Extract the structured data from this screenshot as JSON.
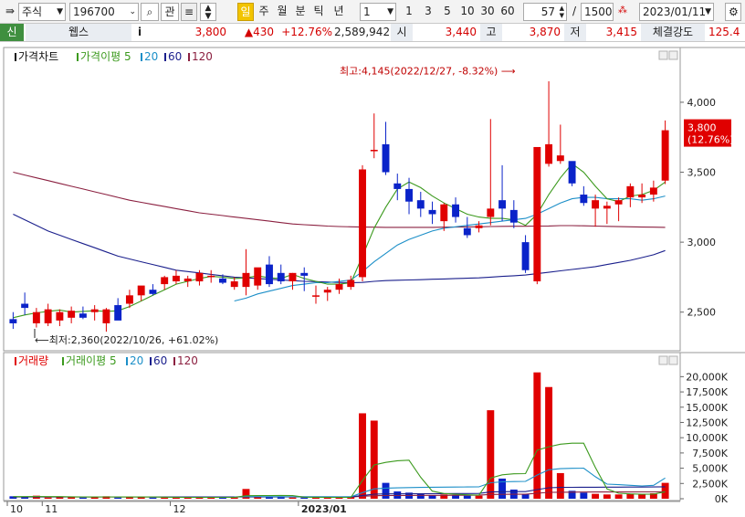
{
  "toolbar": {
    "market": "주식",
    "code": "196700",
    "gwan": "관",
    "periods": [
      "일",
      "주",
      "월",
      "분",
      "틱",
      "년"
    ],
    "multiplier": "1",
    "quick": [
      "1",
      "3",
      "5",
      "10",
      "30",
      "60"
    ],
    "count": "57",
    "total": "1500",
    "date": "2023/01/11",
    "slash": "/"
  },
  "info": {
    "tag": "신",
    "name": "웹스",
    "i": "i",
    "price": "3,800",
    "change": "▲430",
    "rate": "+12.76%",
    "volume": "2,589,942",
    "open_label": "시",
    "open": "3,440",
    "high_label": "고",
    "high": "3,870",
    "low_label": "저",
    "low": "3,415",
    "strength_label": "체결강도",
    "strength": "125.4"
  },
  "colors": {
    "up": "#e00000",
    "down": "#0a23c9",
    "ma5": "#3c9a1e",
    "ma20": "#1c8fc8",
    "ma60": "#1a1f8c",
    "ma120": "#8b2040"
  },
  "chart_data": [
    {
      "type": "candlestick",
      "title": "가격차트",
      "legend": [
        {
          "name": "가격이평",
          "period": "5",
          "color": "#3c9a1e"
        },
        {
          "name": "",
          "period": "20",
          "color": "#1c8fc8"
        },
        {
          "name": "",
          "period": "60",
          "color": "#1a1f8c"
        },
        {
          "name": "",
          "period": "120",
          "color": "#8b2040"
        }
      ],
      "y_ticks": [
        "4,000",
        "3,500",
        "3,000",
        "2,500"
      ],
      "y_tick_values": [
        4000,
        3500,
        3000,
        2500
      ],
      "ylim": [
        2250,
        4300
      ],
      "x_ticks": [
        {
          "label": "10",
          "index": 0
        },
        {
          "label": "11",
          "index": 3
        },
        {
          "label": "12",
          "index": 14
        },
        {
          "label": "2023/01",
          "index": 25
        }
      ],
      "current_label": [
        "3,800",
        "(12.76%)"
      ],
      "annotations": [
        {
          "text": "최고:4,145(2022/12/27, -8.32%)",
          "value": 4145
        },
        {
          "text": "최저:2,360(2022/10/26, +61.02%)",
          "value": 2360
        }
      ],
      "ohlc": [
        [
          2450,
          2500,
          2380,
          2420
        ],
        [
          2560,
          2640,
          2480,
          2530
        ],
        [
          2420,
          2530,
          2390,
          2500
        ],
        [
          2420,
          2560,
          2400,
          2520
        ],
        [
          2440,
          2520,
          2400,
          2500
        ],
        [
          2460,
          2540,
          2420,
          2510
        ],
        [
          2490,
          2540,
          2450,
          2460
        ],
        [
          2500,
          2550,
          2440,
          2520
        ],
        [
          2420,
          2530,
          2360,
          2520
        ],
        [
          2550,
          2600,
          2460,
          2440
        ],
        [
          2560,
          2660,
          2530,
          2620
        ],
        [
          2620,
          2680,
          2580,
          2690
        ],
        [
          2660,
          2700,
          2620,
          2630
        ],
        [
          2700,
          2760,
          2660,
          2750
        ],
        [
          2720,
          2800,
          2700,
          2760
        ],
        [
          2720,
          2760,
          2680,
          2740
        ],
        [
          2720,
          2800,
          2690,
          2780
        ],
        [
          2750,
          2800,
          2710,
          2760
        ],
        [
          2740,
          2770,
          2700,
          2710
        ],
        [
          2680,
          2750,
          2660,
          2720
        ],
        [
          2680,
          2950,
          2620,
          2780
        ],
        [
          2690,
          2760,
          2660,
          2820
        ],
        [
          2840,
          2900,
          2680,
          2700
        ],
        [
          2780,
          2840,
          2700,
          2720
        ],
        [
          2720,
          2780,
          2660,
          2780
        ],
        [
          2780,
          2820,
          2650,
          2760
        ],
        [
          2610,
          2690,
          2560,
          2620
        ],
        [
          2640,
          2680,
          2580,
          2660
        ],
        [
          2660,
          2740,
          2630,
          2700
        ],
        [
          2680,
          2760,
          2660,
          2730
        ],
        [
          2750,
          3550,
          2720,
          3520
        ],
        [
          3650,
          3920,
          3600,
          3660
        ],
        [
          3700,
          3860,
          3480,
          3500
        ],
        [
          3420,
          3490,
          3300,
          3380
        ],
        [
          3380,
          3460,
          3200,
          3290
        ],
        [
          3300,
          3360,
          3180,
          3240
        ],
        [
          3230,
          3290,
          3130,
          3200
        ],
        [
          3150,
          3280,
          3080,
          3270
        ],
        [
          3270,
          3320,
          3140,
          3180
        ],
        [
          3100,
          3180,
          3030,
          3050
        ],
        [
          3100,
          3150,
          3070,
          3120
        ],
        [
          3180,
          3880,
          3120,
          3240
        ],
        [
          3300,
          3550,
          3150,
          3240
        ],
        [
          3230,
          3300,
          3100,
          3140
        ],
        [
          3000,
          3050,
          2780,
          2800
        ],
        [
          2720,
          3680,
          2700,
          3680
        ],
        [
          3560,
          4150,
          3540,
          3700
        ],
        [
          3580,
          3840,
          3560,
          3620
        ],
        [
          3580,
          3550,
          3400,
          3420
        ],
        [
          3340,
          3400,
          3260,
          3280
        ],
        [
          3240,
          3340,
          3110,
          3300
        ],
        [
          3240,
          3290,
          3130,
          3260
        ],
        [
          3270,
          3320,
          3150,
          3300
        ],
        [
          3320,
          3420,
          3250,
          3400
        ],
        [
          3320,
          3420,
          3280,
          3340
        ],
        [
          3340,
          3440,
          3290,
          3390
        ],
        [
          3440,
          3870,
          3415,
          3800
        ]
      ],
      "ma5": [
        2460,
        2480,
        2495,
        2505,
        2515,
        2500,
        2505,
        2510,
        2505,
        2510,
        2540,
        2580,
        2620,
        2660,
        2700,
        2720,
        2740,
        2755,
        2750,
        2740,
        2745,
        2760,
        2745,
        2740,
        2770,
        2740,
        2720,
        2700,
        2700,
        2710,
        2900,
        3100,
        3250,
        3380,
        3430,
        3390,
        3330,
        3280,
        3240,
        3200,
        3180,
        3170,
        3170,
        3160,
        3120,
        3200,
        3340,
        3460,
        3560,
        3500,
        3400,
        3310,
        3290,
        3330,
        3340,
        3370,
        3430
      ],
      "ma20": [
        null,
        null,
        null,
        null,
        null,
        null,
        null,
        null,
        null,
        null,
        null,
        null,
        null,
        null,
        null,
        null,
        null,
        null,
        null,
        2580,
        2600,
        2630,
        2650,
        2670,
        2690,
        2700,
        2710,
        2710,
        2720,
        2730,
        2790,
        2860,
        2920,
        2980,
        3020,
        3050,
        3080,
        3100,
        3110,
        3120,
        3130,
        3140,
        3150,
        3160,
        3170,
        3200,
        3240,
        3280,
        3310,
        3320,
        3320,
        3310,
        3310,
        3310,
        3300,
        3310,
        3330
      ],
      "ma60": [
        3200,
        3160,
        3120,
        3080,
        3050,
        3020,
        2990,
        2960,
        2930,
        2900,
        2880,
        2860,
        2840,
        2820,
        2800,
        2790,
        2780,
        2770,
        2760,
        2750,
        2745,
        2740,
        2735,
        2730,
        2725,
        2720,
        2718,
        2715,
        2712,
        2710,
        2712,
        2720,
        2725,
        2728,
        2730,
        2732,
        2735,
        2737,
        2740,
        2742,
        2745,
        2750,
        2755,
        2760,
        2765,
        2775,
        2785,
        2795,
        2805,
        2815,
        2825,
        2840,
        2855,
        2870,
        2890,
        2910,
        2940
      ],
      "ma120": [
        3500,
        3480,
        3460,
        3440,
        3420,
        3400,
        3380,
        3360,
        3340,
        3320,
        3300,
        3285,
        3270,
        3255,
        3240,
        3225,
        3210,
        3200,
        3190,
        3180,
        3170,
        3160,
        3150,
        3140,
        3130,
        3125,
        3120,
        3115,
        3112,
        3110,
        3108,
        3107,
        3106,
        3106,
        3106,
        3106,
        3106,
        3107,
        3108,
        3109,
        3110,
        3112,
        3113,
        3114,
        3114,
        3115,
        3116,
        3118,
        3118,
        3117,
        3115,
        3113,
        3111,
        3110,
        3108,
        3107,
        3106
      ]
    },
    {
      "type": "bar",
      "title": "거래량",
      "legend": [
        {
          "name": "거래이평",
          "period": "5",
          "color": "#3c9a1e"
        },
        {
          "name": "",
          "period": "20",
          "color": "#1c8fc8"
        },
        {
          "name": "",
          "period": "60",
          "color": "#1a1f8c"
        },
        {
          "name": "",
          "period": "120",
          "color": "#8b2040"
        }
      ],
      "y_ticks": [
        "20,000K",
        "17,500K",
        "15,000K",
        "12,500K",
        "10,000K",
        "7,500K",
        "5,000K",
        "2,500K",
        "0K"
      ],
      "y_tick_values": [
        20000,
        17500,
        15000,
        12500,
        10000,
        7500,
        5000,
        2500,
        0
      ],
      "ylim": [
        0,
        22000
      ],
      "values_k": [
        400,
        300,
        500,
        200,
        300,
        250,
        200,
        300,
        400,
        200,
        300,
        300,
        200,
        200,
        200,
        250,
        200,
        300,
        150,
        200,
        1600,
        300,
        300,
        250,
        200,
        200,
        250,
        200,
        200,
        300,
        14000,
        12800,
        2600,
        1200,
        1000,
        800,
        600,
        700,
        600,
        500,
        500,
        14500,
        3300,
        1500,
        800,
        20700,
        18300,
        4200,
        1300,
        1000,
        800,
        700,
        700,
        800,
        700,
        900,
        2600
      ],
      "vma5": [
        350,
        350,
        360,
        350,
        340,
        310,
        290,
        290,
        300,
        290,
        280,
        290,
        280,
        260,
        240,
        230,
        220,
        230,
        220,
        220,
        490,
        530,
        530,
        540,
        530,
        250,
        240,
        230,
        220,
        230,
        2980,
        5530,
        5960,
        6220,
        6320,
        3520,
        1240,
        860,
        740,
        640,
        580,
        3380,
        3920,
        4080,
        4120,
        7960,
        8520,
        8940,
        9100,
        9100,
        5120,
        1600,
        900,
        800,
        740,
        760,
        1140
      ],
      "vma20": [
        null,
        null,
        null,
        null,
        null,
        null,
        null,
        null,
        null,
        null,
        null,
        null,
        null,
        null,
        null,
        null,
        null,
        null,
        null,
        280,
        340,
        340,
        330,
        330,
        320,
        320,
        320,
        310,
        300,
        310,
        1000,
        1620,
        1730,
        1780,
        1830,
        1860,
        1880,
        1900,
        1920,
        1930,
        1950,
        2620,
        2770,
        2810,
        2840,
        3870,
        4750,
        4920,
        4980,
        5000,
        3600,
        2400,
        2300,
        2200,
        2100,
        2200,
        3400
      ],
      "vma60": [
        300,
        300,
        300,
        300,
        300,
        300,
        300,
        300,
        300,
        300,
        300,
        300,
        300,
        300,
        300,
        300,
        300,
        300,
        300,
        300,
        320,
        320,
        320,
        320,
        320,
        320,
        320,
        320,
        320,
        320,
        540,
        750,
        790,
        800,
        810,
        820,
        830,
        840,
        850,
        860,
        870,
        1100,
        1150,
        1160,
        1170,
        1500,
        1800,
        1850,
        1870,
        1880,
        1890,
        1900,
        1900,
        1910,
        1920,
        1930,
        1960
      ],
      "vma120": [
        280,
        280,
        280,
        280,
        280,
        280,
        280,
        280,
        280,
        280,
        280,
        280,
        280,
        280,
        280,
        280,
        280,
        280,
        280,
        280,
        290,
        290,
        290,
        290,
        290,
        290,
        290,
        290,
        290,
        290,
        400,
        500,
        520,
        530,
        540,
        550,
        560,
        560,
        570,
        570,
        580,
        700,
        720,
        730,
        740,
        900,
        1050,
        1070,
        1080,
        1090,
        1100,
        1100,
        1110,
        1110,
        1120,
        1120,
        1140
      ]
    }
  ]
}
